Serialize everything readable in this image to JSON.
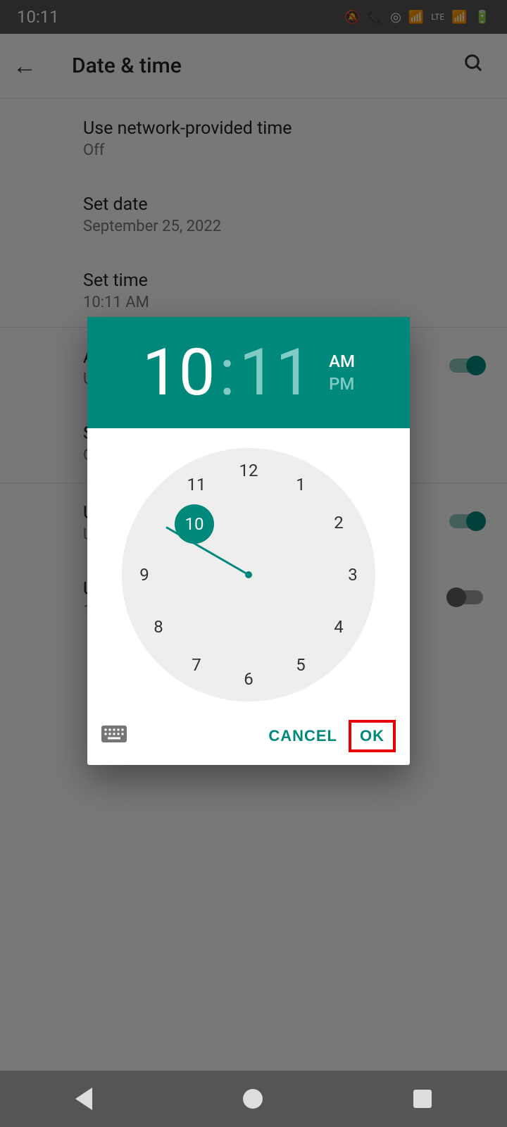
{
  "status": {
    "time": "10:11",
    "lte": "LTE"
  },
  "header": {
    "title": "Date & time"
  },
  "settings": {
    "network_time": {
      "title": "Use network-provided time",
      "sub": "Off"
    },
    "set_date": {
      "title": "Set date",
      "sub": "September 25, 2022"
    },
    "set_time": {
      "title": "Set time",
      "sub": "10:11 AM"
    },
    "auto_tz": {
      "title_partial": "A",
      "sub_partial": "U"
    },
    "set_tz": {
      "title_partial": "S",
      "sub_partial": "C"
    },
    "locale_default": {
      "title_partial": "U",
      "sub_partial": "U"
    },
    "use_24h": {
      "title_partial": "U",
      "sub_partial": "1"
    }
  },
  "dialog": {
    "hour": "10",
    "minute": "11",
    "am": "AM",
    "pm": "PM",
    "cancel": "CANCEL",
    "ok": "OK",
    "selected_number": "10",
    "numbers": {
      "n1": "1",
      "n2": "2",
      "n3": "3",
      "n4": "4",
      "n5": "5",
      "n6": "6",
      "n7": "7",
      "n8": "8",
      "n9": "9",
      "n10": "10",
      "n11": "11",
      "n12": "12"
    }
  }
}
